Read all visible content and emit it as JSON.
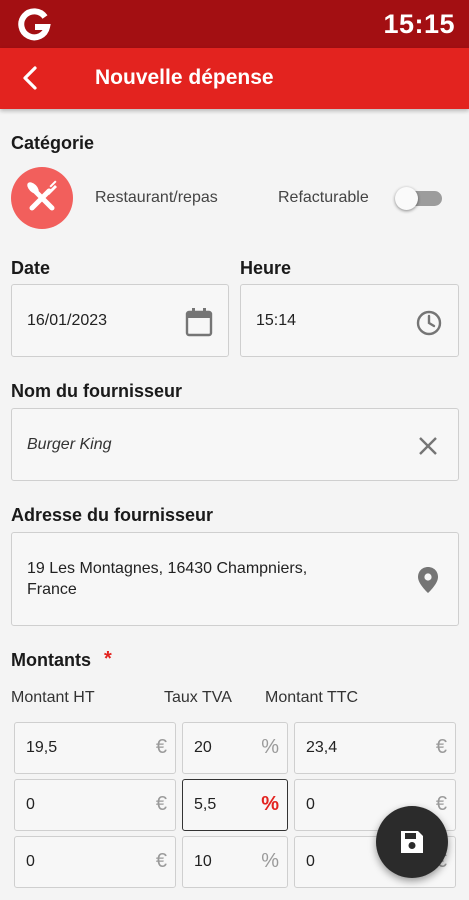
{
  "status_bar": {
    "time": "15:15",
    "logo_icon": "g-logo-icon"
  },
  "app_bar": {
    "title": "Nouvelle dépense",
    "back_icon": "arrow-back-icon"
  },
  "category": {
    "heading": "Catégorie",
    "name": "Restaurant/repas",
    "icon": "fork-knife-icon",
    "rebillable_label": "Refacturable",
    "rebillable_on": false
  },
  "date": {
    "label": "Date",
    "value": "16/01/2023",
    "icon": "calendar-icon"
  },
  "time": {
    "label": "Heure",
    "value": "15:14",
    "icon": "clock-icon"
  },
  "supplier": {
    "label": "Nom du fournisseur",
    "value": "Burger King",
    "clear_icon": "close-icon"
  },
  "address": {
    "label": "Adresse du fournisseur",
    "line1": "19 Les Montagnes, 16430 Champniers,",
    "line2": "France",
    "icon": "location-pin-icon"
  },
  "amounts": {
    "heading": "Montants",
    "required_mark": "*",
    "col_ht": "Montant HT",
    "col_tva": "Taux TVA",
    "col_ttc": "Montant TTC",
    "rows": [
      {
        "ht": "19,5",
        "tva": "20",
        "ttc": "23,4"
      },
      {
        "ht": "0",
        "tva": "5,5",
        "ttc": "0"
      },
      {
        "ht": "0",
        "tva": "10",
        "ttc": "0"
      }
    ],
    "currency": "€",
    "percent": "%"
  },
  "save_fab": {
    "icon": "save-icon"
  },
  "colors": {
    "primary": "#e3231f",
    "status_bar": "#a30f12",
    "category_circle": "#f25f5c",
    "fab": "#2b2b2b"
  }
}
